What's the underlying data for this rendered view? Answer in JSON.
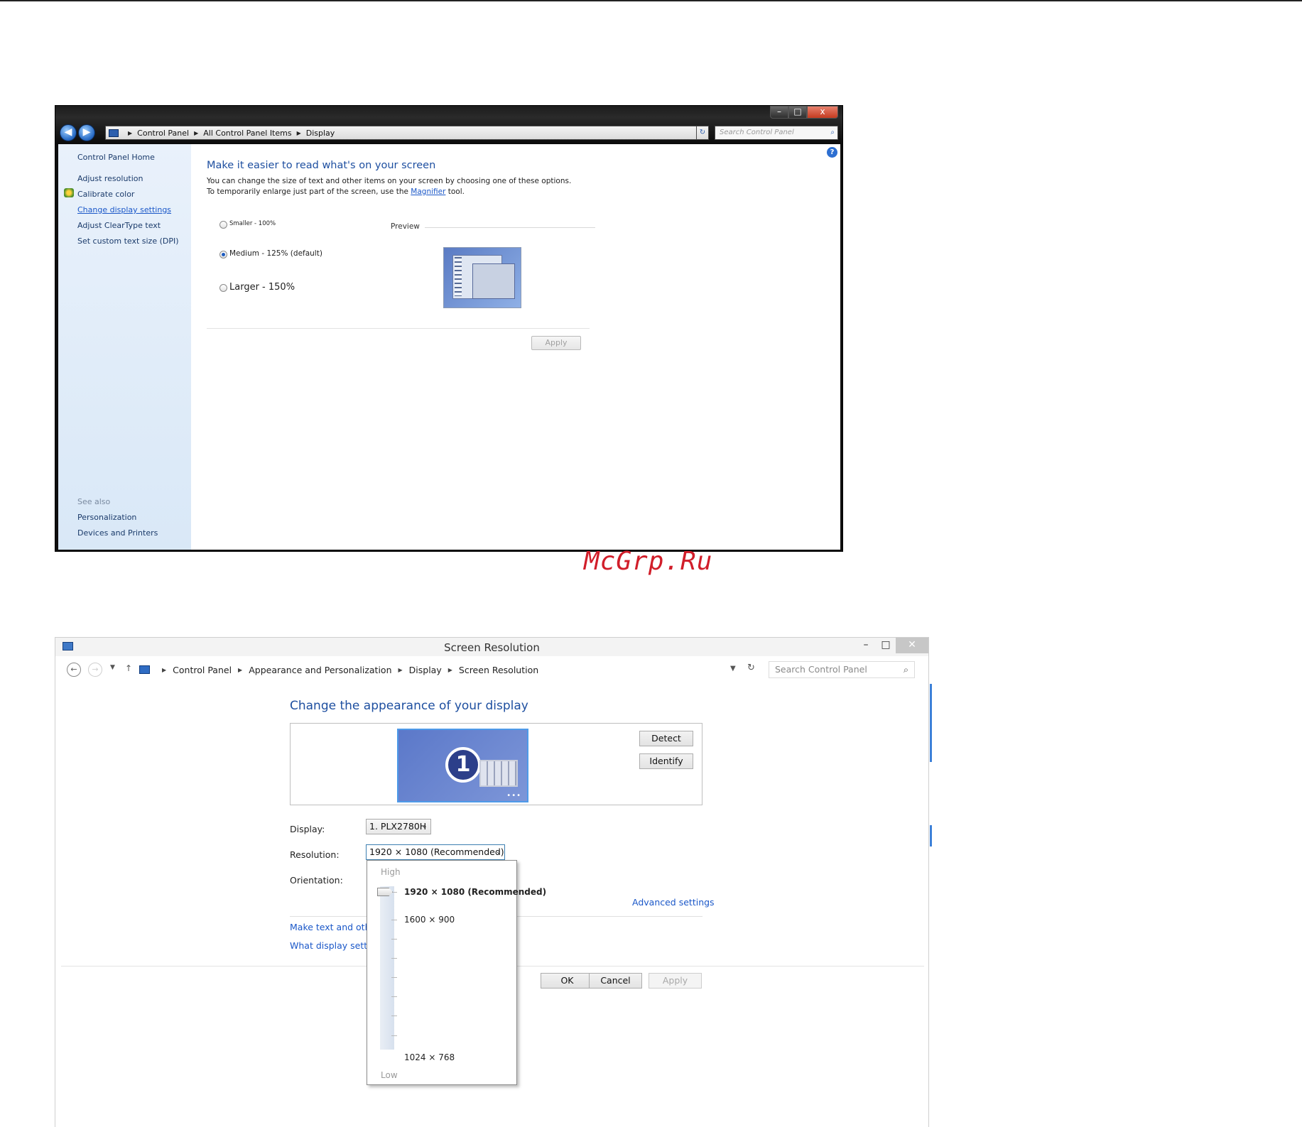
{
  "watermark": "McGrp.Ru",
  "window1": {
    "caption_buttons": {
      "minimize": "–",
      "maximize": "□",
      "close": "x"
    },
    "breadcrumb": [
      "Control Panel",
      "All Control Panel Items",
      "Display"
    ],
    "search_placeholder": "Search Control Panel",
    "sidebar": {
      "home": "Control Panel Home",
      "items": [
        "Adjust resolution",
        "Calibrate color",
        "Change display settings",
        "Adjust ClearType text",
        "Set custom text size (DPI)"
      ],
      "see_also": "See also",
      "see_also_items": [
        "Personalization",
        "Devices and Printers"
      ]
    },
    "heading": "Make it easier to read what's on your screen",
    "description_before_link": "You can change the size of text and other items on your screen by choosing one of these options. To temporarily enlarge just part of the screen, use the ",
    "magnifier_link": "Magnifier",
    "description_after_link": " tool.",
    "options": [
      {
        "label": "Smaller - 100%",
        "selected": false
      },
      {
        "label": "Medium - 125% (default)",
        "selected": true
      },
      {
        "label": "Larger - 150%",
        "selected": false
      }
    ],
    "preview_label": "Preview",
    "apply_label": "Apply"
  },
  "window2": {
    "title": "Screen Resolution",
    "caption_buttons": {
      "minimize": "–",
      "maximize": "□",
      "close": "✕"
    },
    "breadcrumb": [
      "Control Panel",
      "Appearance and Personalization",
      "Display",
      "Screen Resolution"
    ],
    "search_placeholder": "Search Control Panel",
    "heading": "Change the appearance of your display",
    "monitor_number": "1",
    "detect_label": "Detect",
    "identify_label": "Identify",
    "display_label": "Display:",
    "display_value": "1. PLX2780H",
    "resolution_label": "Resolution:",
    "resolution_value": "1920 × 1080 (Recommended)",
    "orientation_label": "Orientation:",
    "advanced_settings": "Advanced settings",
    "link_text_size": "Make text and other items larger or smaller",
    "link_what_settings": "What display settings should I choose?",
    "ok_label": "OK",
    "cancel_label": "Cancel",
    "apply_label": "Apply",
    "resolution_dropdown": {
      "high_label": "High",
      "low_label": "Low",
      "options": [
        "1920 × 1080 (Recommended)",
        "1600 × 900",
        "1024 × 768"
      ],
      "selected_index": 0
    }
  }
}
